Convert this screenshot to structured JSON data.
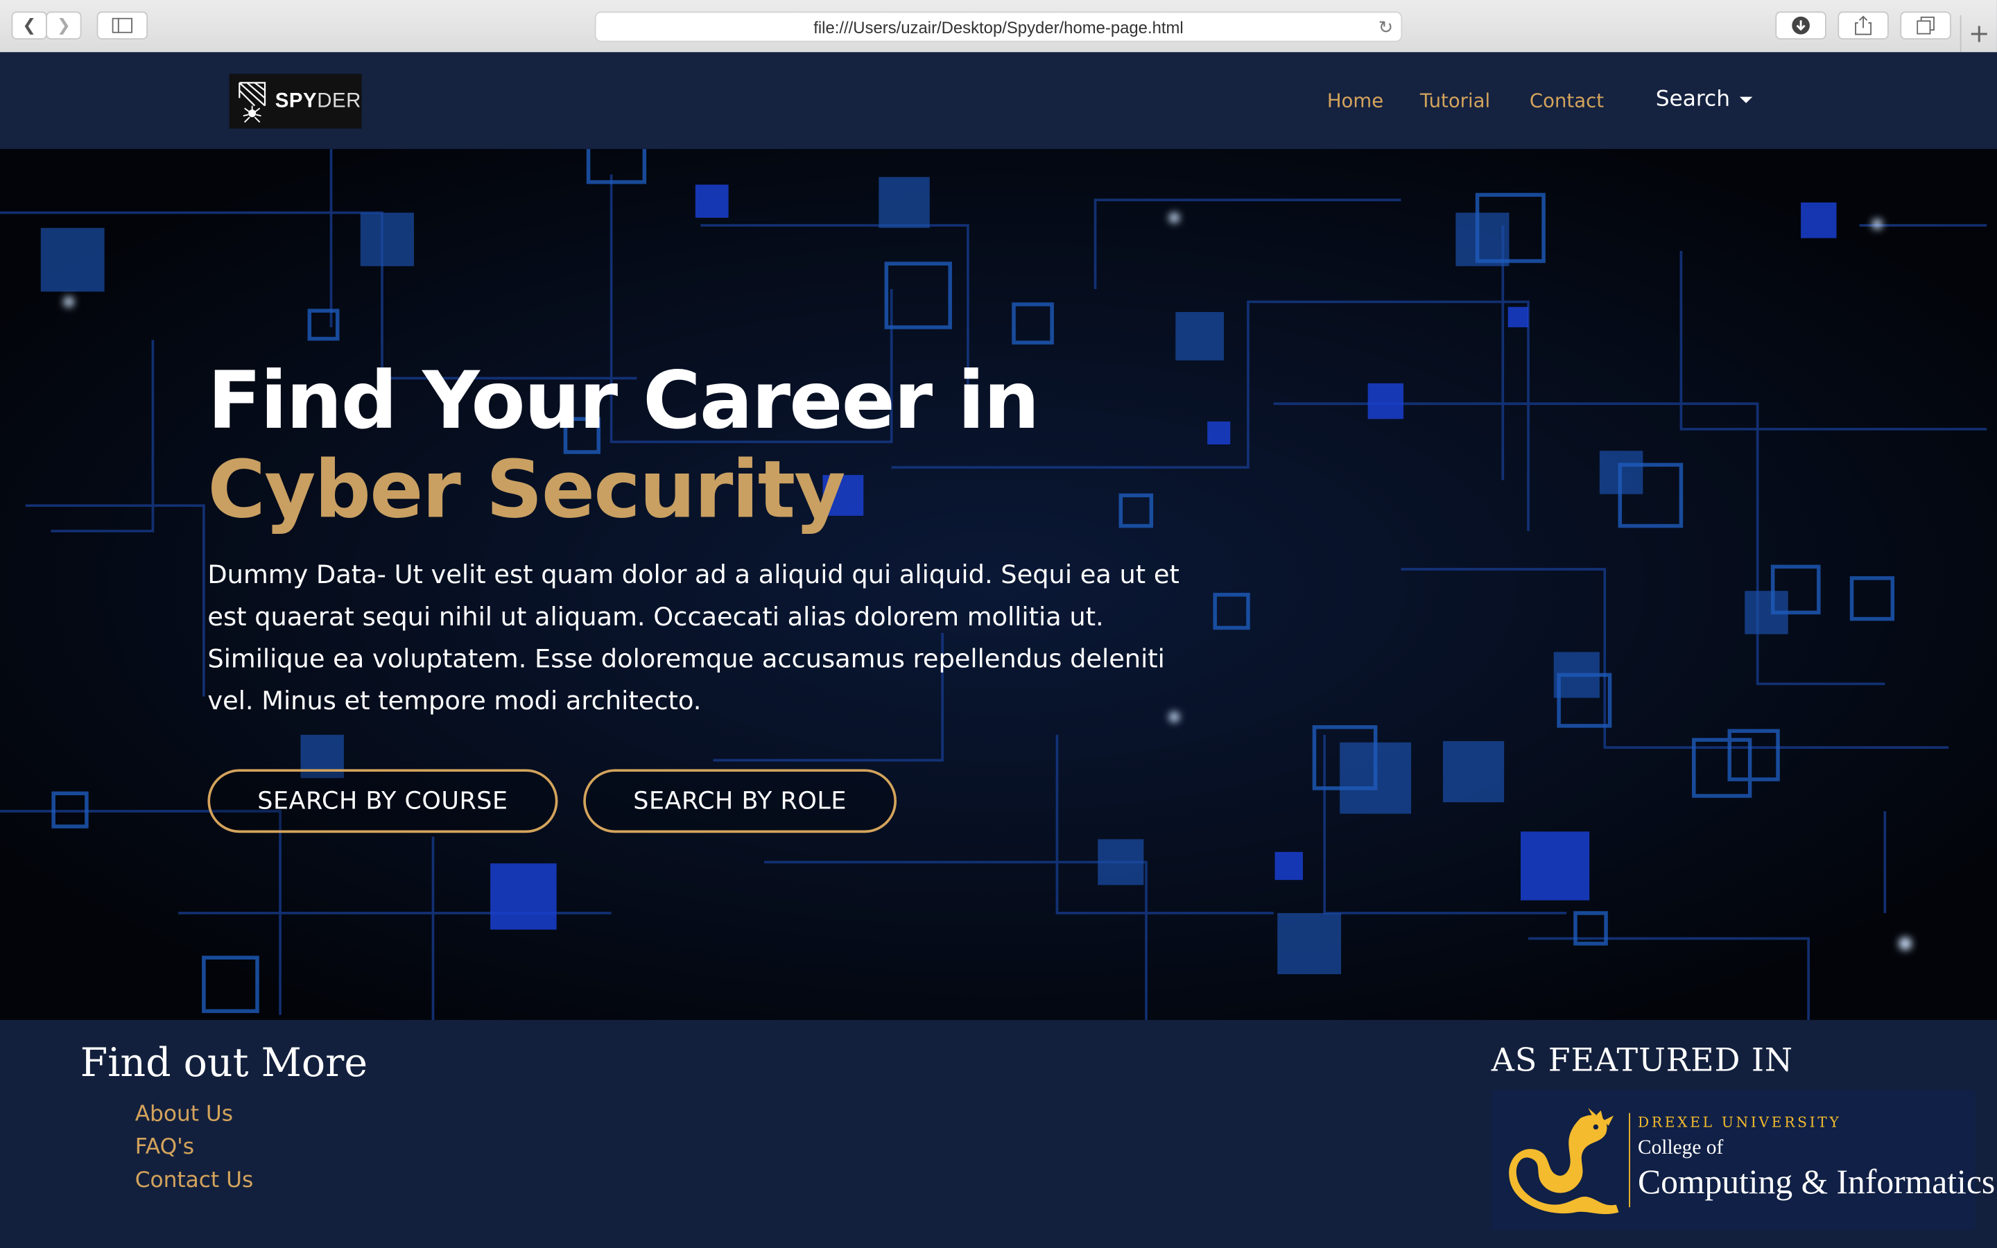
{
  "browser": {
    "url": "file:///Users/uzair/Desktop/Spyder/home-page.html",
    "back_icon": "chevron-left-icon",
    "forward_icon": "chevron-right-icon"
  },
  "nav": {
    "logo_bold": "SPY",
    "logo_thin": "DER",
    "links": [
      "Home",
      "Tutorial",
      "Contact"
    ],
    "search_label": "Search"
  },
  "hero": {
    "title_line1": "Find Your Career in",
    "title_line2": "Cyber Security",
    "text": "Dummy Data- Ut velit est quam dolor ad a aliquid qui aliquid. Sequi ea ut et est quaerat sequi nihil ut aliquam. Occaecati alias dolorem mollitia ut. Similique ea voluptatem. Esse doloremque accusamus repellendus deleniti vel. Minus et tempore modi architecto.",
    "button_course": "SEARCH BY COURSE",
    "button_role": "SEARCH BY ROLE"
  },
  "footer": {
    "find_title": "Find out More",
    "links": [
      "About Us",
      "FAQ's",
      "Contact Us"
    ],
    "featured_title": "AS FEATURED IN",
    "drexel_university": "DREXEL UNIVERSITY",
    "drexel_college_of": "College of",
    "drexel_computing": "Computing & Informatics"
  },
  "colors": {
    "gold": "#d4a45c",
    "navy": "#13203d",
    "drexel_gold": "#f4bb2e"
  }
}
